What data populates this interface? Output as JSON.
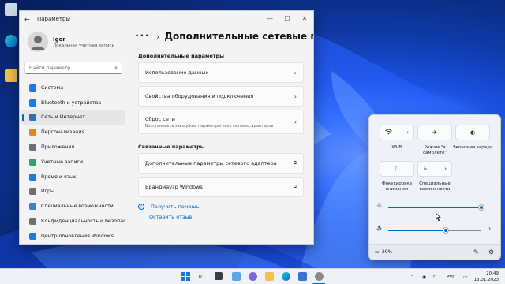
{
  "settings_window": {
    "title": "Параметры",
    "user": {
      "name": "Igor",
      "subtitle": "Локальная учетная запись"
    },
    "search_placeholder": "Найти параметр",
    "nav_items": [
      {
        "label": "Система",
        "icon": "monitor-icon",
        "color": "#1f7be0"
      },
      {
        "label": "Bluetooth и устройства",
        "icon": "bluetooth-icon",
        "color": "#1f7be0"
      },
      {
        "label": "Сеть и Интернет",
        "icon": "network-icon",
        "color": "#2d6fb5"
      },
      {
        "label": "Персонализация",
        "icon": "brush-icon",
        "color": "#e08a1f"
      },
      {
        "label": "Приложения",
        "icon": "apps-icon",
        "color": "#6b6f7a"
      },
      {
        "label": "Учетные записи",
        "icon": "person-icon",
        "color": "#2fa36b"
      },
      {
        "label": "Время и язык",
        "icon": "globe-clock-icon",
        "color": "#1f7be0"
      },
      {
        "label": "Игры",
        "icon": "gamepad-icon",
        "color": "#6b6f7a"
      },
      {
        "label": "Специальные возможности",
        "icon": "accessibility-icon",
        "color": "#3b82d6"
      },
      {
        "label": "Конфиденциальность и безопасность",
        "icon": "shield-icon",
        "color": "#6b6f7a"
      },
      {
        "label": "Центр обновления Windows",
        "icon": "update-icon",
        "color": "#1f7be0"
      }
    ],
    "active_nav_index": 2,
    "breadcrumb_dots": "•••",
    "page_title": "Дополнительные сетевые параметры",
    "section1_title": "Дополнительные параметры",
    "cards": [
      {
        "title": "Использование данных",
        "subtitle": ""
      },
      {
        "title": "Свойства оборудования и подключения",
        "subtitle": ""
      },
      {
        "title": "Сброс сети",
        "subtitle": "Восстановить заводские параметры всех сетевых адаптеров"
      }
    ],
    "section2_title": "Связанные параметры",
    "related": [
      {
        "title": "Дополнительные параметры сетевого адаптера"
      },
      {
        "title": "Брандмауэр Windows"
      }
    ],
    "help_link": "Получить помощь",
    "feedback_link": "Оставить отзыв"
  },
  "quick_settings": {
    "tiles": [
      {
        "label": "Wi-Fi",
        "icon": "wifi-icon"
      },
      {
        "label": "Режим \"в самолете\"",
        "icon": "airplane-icon"
      },
      {
        "label": "Экономия заряда",
        "icon": "battery-saver-icon"
      },
      {
        "label": "Фокусировка внимания",
        "icon": "moon-icon"
      },
      {
        "label": "Специальные возможности",
        "icon": "accessibility-icon"
      }
    ],
    "brightness_level": 1.0,
    "volume_level": 0.62,
    "battery_percent": "29%"
  },
  "taskbar": {
    "language": "РУС",
    "time": "20:49",
    "date": "13.01.2023"
  }
}
